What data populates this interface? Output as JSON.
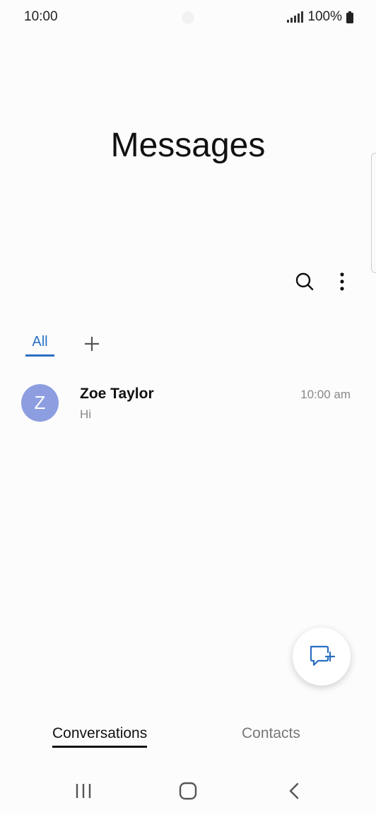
{
  "status_bar": {
    "time": "10:00",
    "battery": "100%"
  },
  "header": {
    "title": "Messages"
  },
  "toolbar": {
    "search_icon": "search-icon",
    "more_icon": "more-vertical-icon"
  },
  "filter_tabs": {
    "all_label": "All",
    "add_icon": "plus-icon"
  },
  "conversations": [
    {
      "avatar_letter": "Z",
      "name": "Zoe Taylor",
      "preview": "Hi",
      "time": "10:00 am"
    }
  ],
  "fab": {
    "icon": "new-message-icon"
  },
  "bottom_tabs": {
    "conversations_label": "Conversations",
    "contacts_label": "Contacts"
  },
  "nav": {
    "recents_icon": "recents-icon",
    "home_icon": "home-icon",
    "back_icon": "back-icon"
  },
  "colors": {
    "accent": "#2a6fc2",
    "avatar": "#8c9ee0",
    "background": "#fcfcfc"
  }
}
